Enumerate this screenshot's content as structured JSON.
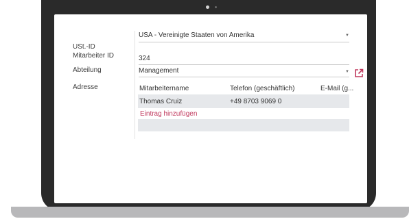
{
  "form": {
    "country_value": "USA - Vereinigte Staaten von Amerika",
    "ust_label": "USt.-ID",
    "employee_id_label": "Mitarbeiter ID",
    "employee_id_value": "324",
    "department_label": "Abteilung",
    "department_value": "Management",
    "address_label": "Adresse"
  },
  "table": {
    "columns": [
      "Mitarbeitername",
      "Telefon (geschäftlich)",
      "E-Mail (g..."
    ],
    "rows": [
      [
        "Thomas Cruiz",
        "+49 8703 9069 0",
        ""
      ]
    ],
    "add_label": "Eintrag hinzufügen"
  },
  "colors": {
    "accent": "#c0385d",
    "row_bg": "#e6e8eb"
  },
  "icons": {
    "external_link": "external-link-icon",
    "dropdown": "chevron-down-icon"
  }
}
